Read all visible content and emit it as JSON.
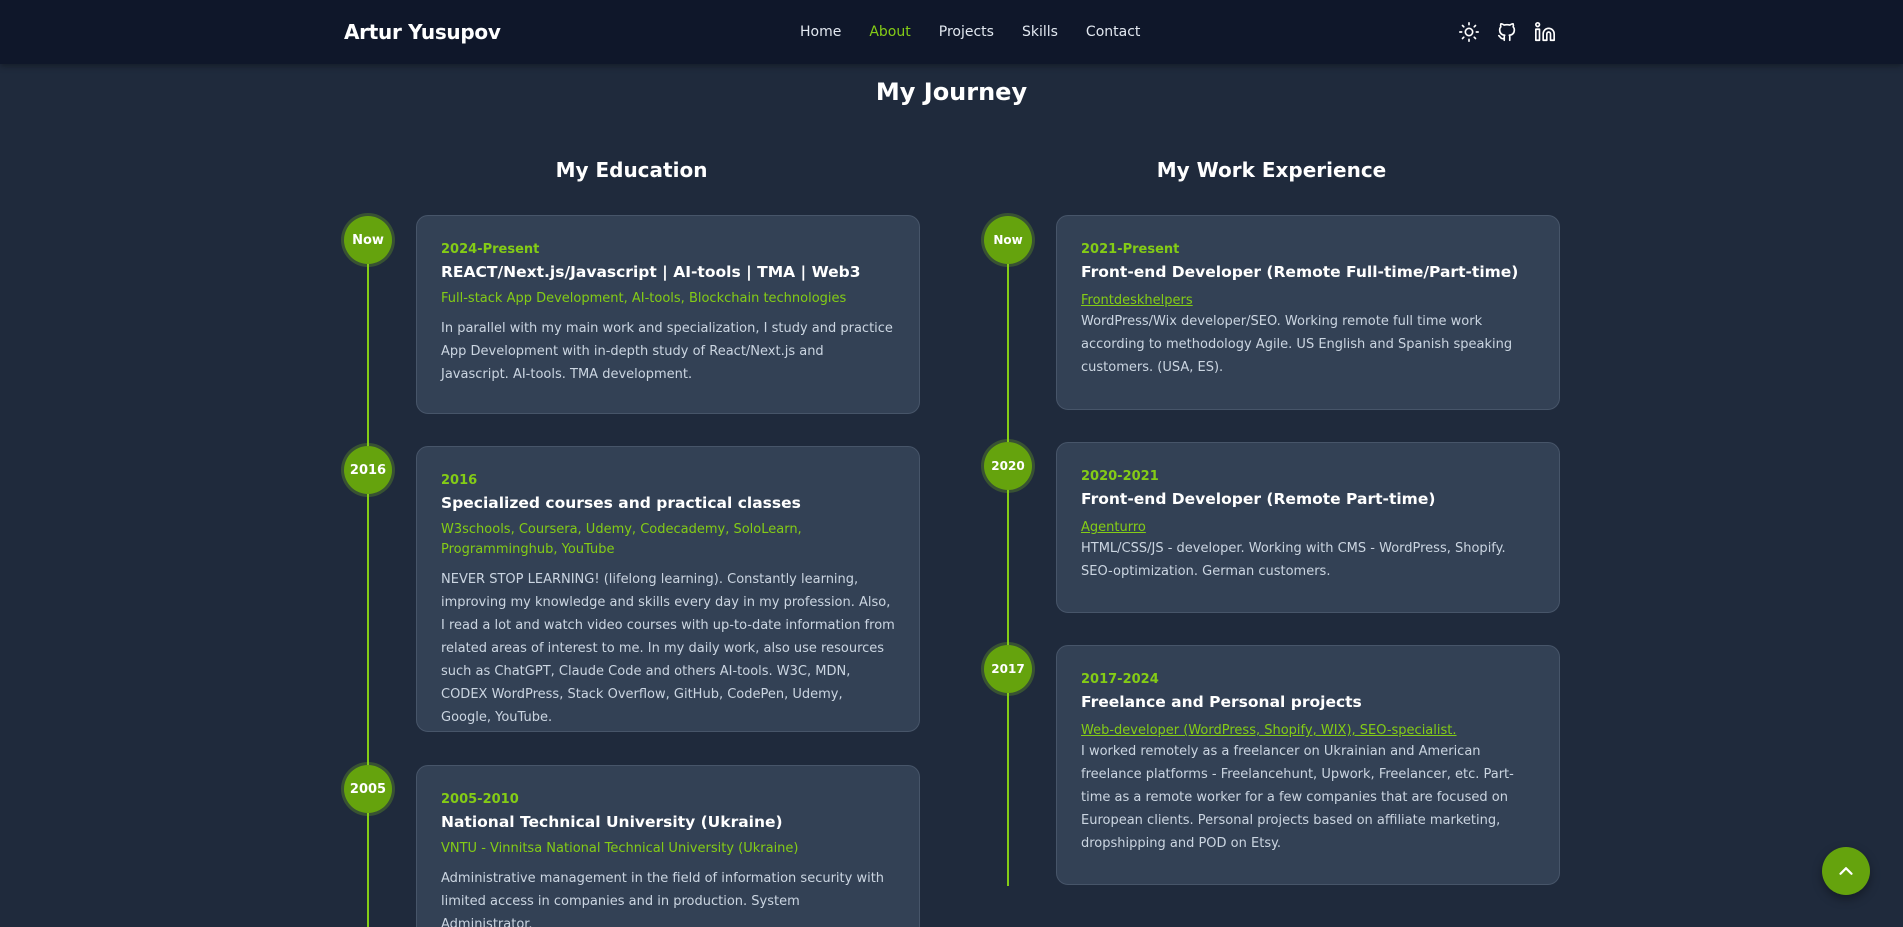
{
  "header": {
    "brand": "Artur Yusupov",
    "nav": [
      {
        "label": "Home",
        "active": false
      },
      {
        "label": "About",
        "active": true
      },
      {
        "label": "Projects",
        "active": false
      },
      {
        "label": "Skills",
        "active": false
      },
      {
        "label": "Contact",
        "active": false
      }
    ],
    "icons": [
      "sun-icon",
      "github-icon",
      "linkedin-icon"
    ]
  },
  "page_title": "My Journey",
  "education": {
    "title": "My Education",
    "items": [
      {
        "badge": "Now",
        "period": "2024-Present",
        "title": "REACT/Next.js/Javascript | AI-tools | TMA | Web3",
        "subtitle": "Full-stack App Development, AI-tools, Blockchain technologies",
        "description": "In parallel with my main work and specialization, I study and practice App Development with in-depth study of React/Next.js and Javascript. AI-tools. TMA development."
      },
      {
        "badge": "2016",
        "period": "2016",
        "title": "Specialized courses and practical classes",
        "subtitle": "W3schools, Coursera, Udemy, Codecademy, SoloLearn, Programminghub, YouTube",
        "description": "NEVER STOP LEARNING! (lifelong learning). Constantly learning, improving my knowledge and skills every day in my profession. Also, I read a lot and watch video courses with up-to-date information from related areas of interest to me. In my daily work, also use resources such as ChatGPT, Claude Code and others AI-tools. W3C, MDN, CODEX WordPress, Stack Overflow, GitHub, CodePen, Udemy, Google, YouTube."
      },
      {
        "badge": "2005",
        "period": "2005-2010",
        "title": "National Technical University (Ukraine)",
        "subtitle": "VNTU - Vinnitsa National Technical University (Ukraine)",
        "description": "Administrative management in the field of information security with limited access in companies and in production. System Administrator."
      }
    ]
  },
  "work": {
    "title": "My Work Experience",
    "items": [
      {
        "badge": "Now",
        "period": "2021-Present",
        "title": "Front-end Developer (Remote Full-time/Part-time)",
        "company": "Frontdeskhelpers",
        "description": "WordPress/Wix developer/SEO. Working remote full time work according to methodology Agile. US English and Spanish speaking customers. (USA, ES)."
      },
      {
        "badge": "2020",
        "period": "2020-2021",
        "title": "Front-end Developer (Remote Part-time)",
        "company": "Agenturro",
        "description": "HTML/CSS/JS - developer. Working with CMS - WordPress, Shopify. SEO-optimization. German customers."
      },
      {
        "badge": "2017",
        "period": "2017-2024",
        "title": "Freelance and Personal projects",
        "company": "Web-developer (WordPress, Shopify, WIX), SEO-specialist.",
        "description": "I worked remotely as a freelancer on Ukrainian and American freelance platforms - Freelancehunt, Upwork, Freelancer, etc. Part-time as a remote worker for a few companies that are focused on European clients. Personal projects based on affiliate marketing, dropshipping and POD on Etsy."
      }
    ]
  },
  "scroll_top_icon": "arrow-up-icon",
  "colors": {
    "accent": "#84cc16",
    "background": "#1f2a3c",
    "card": "#334155",
    "navbar": "#0f172a"
  }
}
